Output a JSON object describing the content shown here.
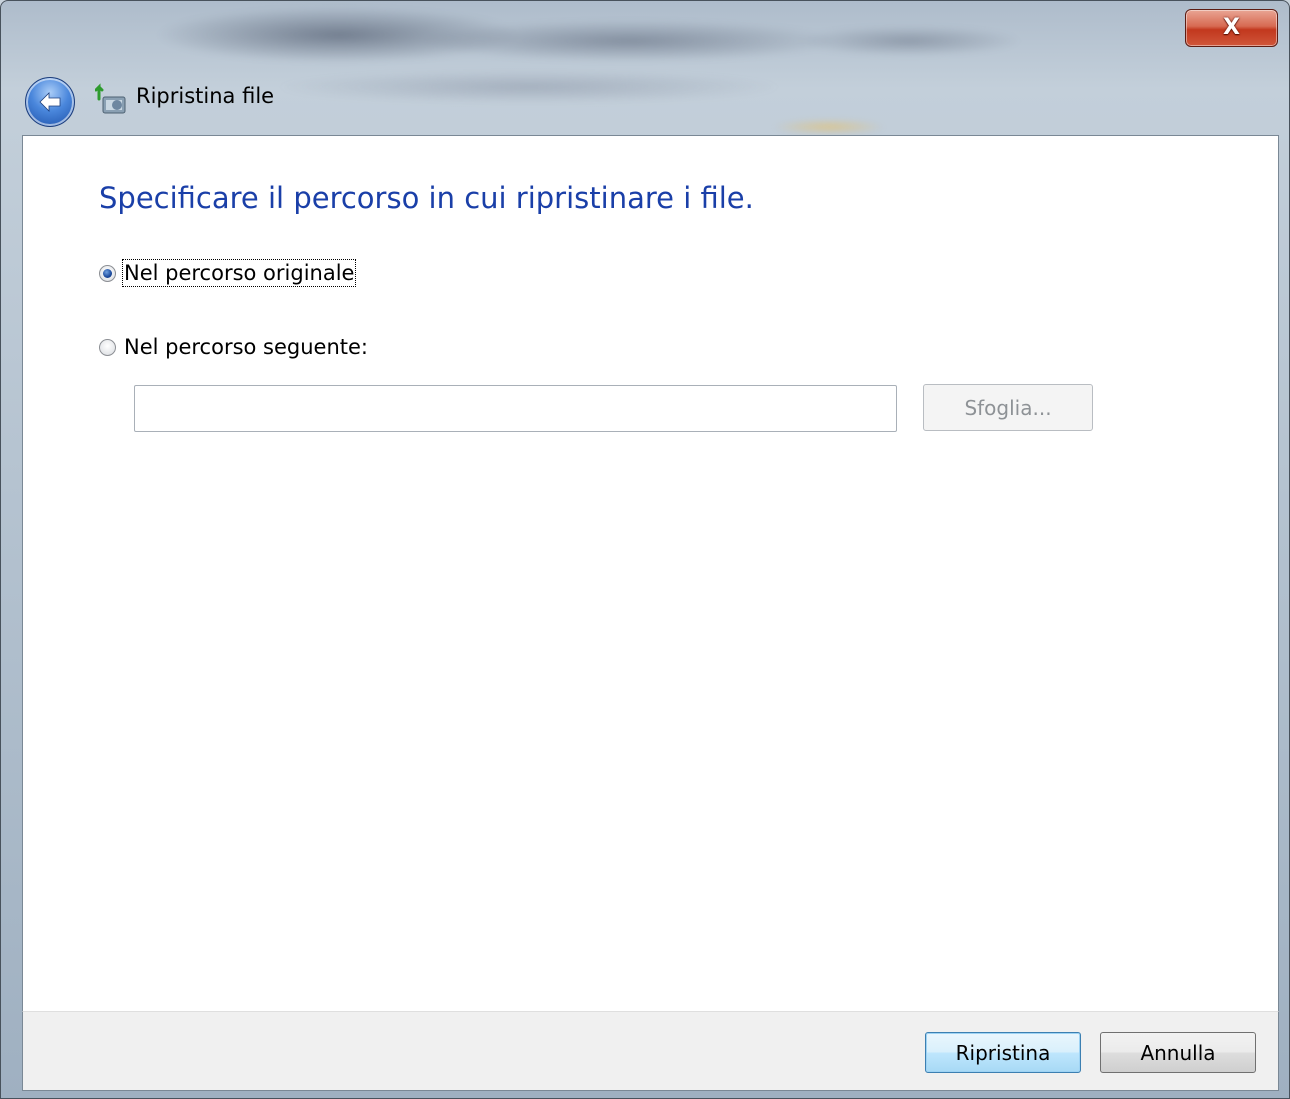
{
  "window": {
    "title": "Ripristina file",
    "close_label": "X"
  },
  "content": {
    "heading": "Specificare il percorso in cui ripristinare i file.",
    "options": [
      {
        "label": "Nel percorso originale",
        "selected": true
      },
      {
        "label": "Nel percorso seguente:",
        "selected": false
      }
    ],
    "path_input": {
      "value": "",
      "placeholder": ""
    },
    "browse_label": "Sfoglia..."
  },
  "footer": {
    "restore_label": "Ripristina",
    "cancel_label": "Annulla"
  },
  "colors": {
    "heading": "#1a3fa8",
    "close_button": "#c2381e",
    "back_button": "#2f6ccc"
  },
  "icons": {
    "back": "back-arrow-icon",
    "app": "restore-files-icon",
    "close": "close-icon"
  }
}
